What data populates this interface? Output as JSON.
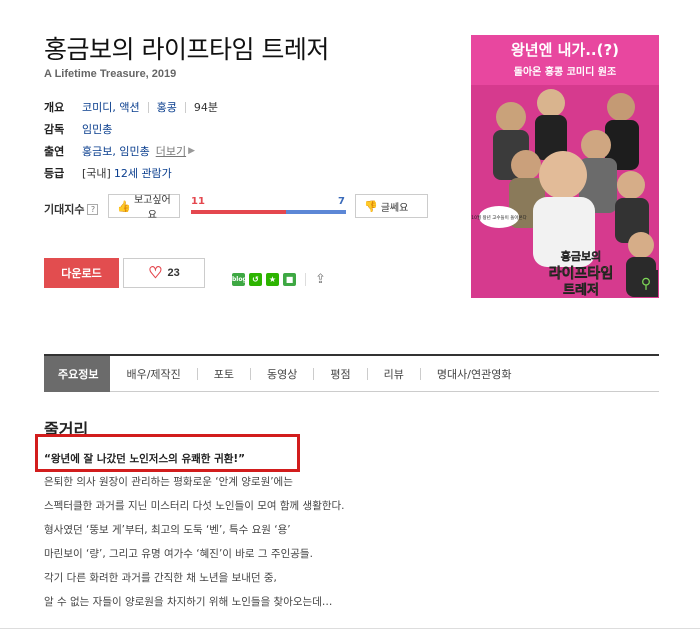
{
  "movie": {
    "title": "홍금보의 라이프타임 트레저",
    "subtitle": "A Lifetime Treasure, 2019"
  },
  "info": {
    "overview_label": "개요",
    "genre": "코미디, 액션",
    "country": "홍콩",
    "runtime": "94분",
    "director_label": "감독",
    "director": "임민총",
    "cast_label": "출연",
    "cast": "홍금보, 임민총",
    "cast_more": "더보기",
    "rating_label": "등급",
    "rating_prefix": "[국내]",
    "rating": "12세 관람가"
  },
  "expectation": {
    "label": "기대지수",
    "help": "?",
    "want_label": "보고싶어요",
    "not_want_label": "글쎄요",
    "want_count": "11",
    "not_want_count": "7",
    "want_fraction": 0.61
  },
  "actions": {
    "download_label": "다운로드",
    "like_count": "23",
    "blog_icon_text": "blog"
  },
  "poster": {
    "headline": "왕년엔 내가..(?)",
    "tagline": "돌아온 홍콩 코미디 원조",
    "badge": "10월 왕년 고수들이 돌아온다",
    "title_line1": "홍금보의",
    "title_line2": "라이프타임",
    "title_line3": "트레저"
  },
  "tabs": [
    {
      "label": "주요정보",
      "active": true
    },
    {
      "label": "배우/제작진"
    },
    {
      "label": "포토"
    },
    {
      "label": "동영상"
    },
    {
      "label": "평점"
    },
    {
      "label": "리뷰"
    },
    {
      "label": "명대사/연관영화"
    }
  ],
  "synopsis": {
    "heading": "줄거리",
    "quote": "“왕년에 잘 나갔던 노인저스의 유쾌한 귀환!”",
    "lines": [
      "은퇴한 의사 원장이 관리하는 평화로운 ‘안계 양로원’에는",
      "스펙터클한 과거를 지닌 미스터리 다섯 노인들이 모여 함께 생활한다.",
      "형사였던 ‘뚱보 게’부터, 최고의 도둑 ‘벤’, 특수 요원 ‘용’",
      "마린보이 ‘량’, 그리고 유명 여가수 ‘혜진’이 바로 그 주인공들.",
      "각기 다른 화려한 과거를 간직한 채 노년을 보내던 중,",
      "알 수 없는 자들이 양로원을 차지하기 위해 노인들을 찾아오는데…"
    ]
  },
  "colors": {
    "accent_red": "#e24d4f",
    "link_blue": "#0a3e8e",
    "highlight_border": "#d21d1d",
    "poster_bg": "#e8479f"
  }
}
